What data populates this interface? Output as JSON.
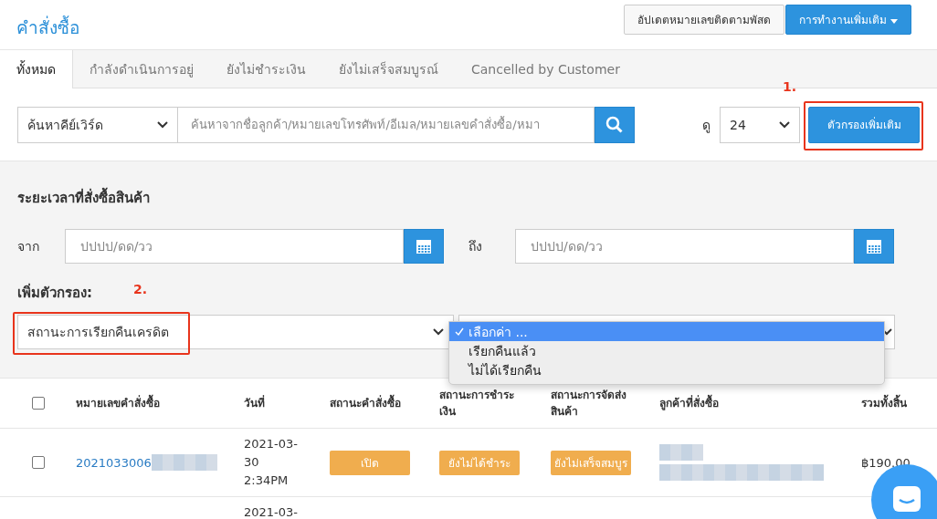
{
  "header": {
    "title": "คำสั่งซื้อ",
    "buttons": [
      {
        "label": "อัปเดตหมายเลขติดตามพัสด",
        "kind": "default"
      },
      {
        "label": "การทำงานเพิ่มเติม",
        "kind": "primary"
      }
    ]
  },
  "tabs": [
    {
      "label": "ทั้งหมด",
      "selected": true
    },
    {
      "label": "กำลังดำเนินการอยู่",
      "selected": false
    },
    {
      "label": "ยังไม่ชำระเงิน",
      "selected": false
    },
    {
      "label": "ยังไม่เสร็จสมบูรณ์",
      "selected": false
    },
    {
      "label": "Cancelled by Customer",
      "selected": false
    }
  ],
  "search": {
    "field_select": "ค้นหาคีย์เวิร์ด",
    "placeholder": "ค้นหาจากชื่อลูกค้า/หมายเลขโทรศัพท์/อีเมล/หมายเลขคำสั่งซื้อ/หมา",
    "view_label": "ดู",
    "page_size": "24",
    "filter_button": "ตัวกรองเพิ่มเติม",
    "annotation": "1."
  },
  "filters": {
    "date_title": "ระยะเวลาที่สั่งซื้อสินค้า",
    "from_label": "จาก",
    "from_placeholder": "ปปปป/ดด/วว",
    "to_label": "ถึง",
    "to_placeholder": "ปปปป/ดด/วว",
    "add_filter_label": "เพิ่มตัวกรอง:",
    "annotation": "2.",
    "filter_select": "สถานะการเรียกคืนเครดิต",
    "options": [
      {
        "label": "เลือกค่า ...",
        "selected": true
      },
      {
        "label": "เรียกคืนแล้ว",
        "selected": false
      },
      {
        "label": "ไม่ได้เรียกคืน",
        "selected": false
      }
    ]
  },
  "table": {
    "columns": [
      "หมายเลขคำสั่งซื้อ",
      "วันที่",
      "สถานะคำสั่งซื้อ",
      "สถานะการชำระเงิน",
      "สถานะการจัดส่งสินค้า",
      "ลูกค้าที่สั่งซื้อ",
      "รวมทั้งสิ้น"
    ],
    "rows": [
      {
        "checked": false,
        "order": "2021033006",
        "redacted": true,
        "date": "2021-03-30 2:34PM",
        "status": "เปิด",
        "payment": "ยังไม่ได้ชำระ",
        "shipping": "ยังไม่เสร็จสมบูร",
        "total": "฿190.00"
      },
      {
        "date": "2021-03-"
      }
    ],
    "select_all_checked": false
  }
}
